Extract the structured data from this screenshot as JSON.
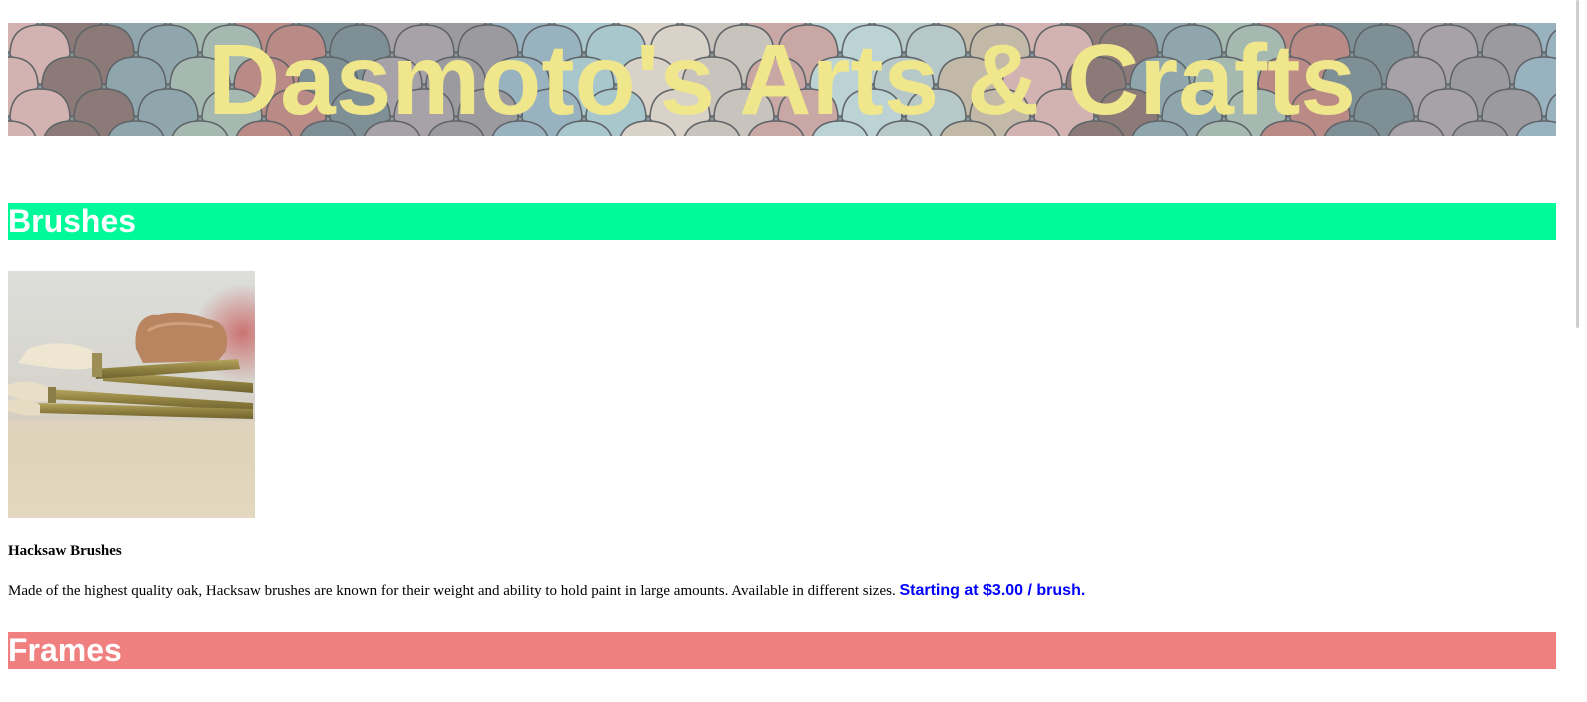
{
  "banner": {
    "title": "Dasmoto's Arts & Crafts",
    "title_color": "#f0e68c"
  },
  "sections": {
    "brushes": {
      "label": "Brushes",
      "color": "#00fa9a"
    },
    "frames": {
      "label": "Frames",
      "color": "#f08080"
    }
  },
  "product": {
    "name": "Hacksaw Brushes",
    "description": "Made of the highest quality oak, Hacksaw brushes are known for their weight and ability to hold paint in large amounts. Available in different sizes.",
    "price": "Starting at $3.00 / brush.",
    "price_color": "#0000ff"
  }
}
